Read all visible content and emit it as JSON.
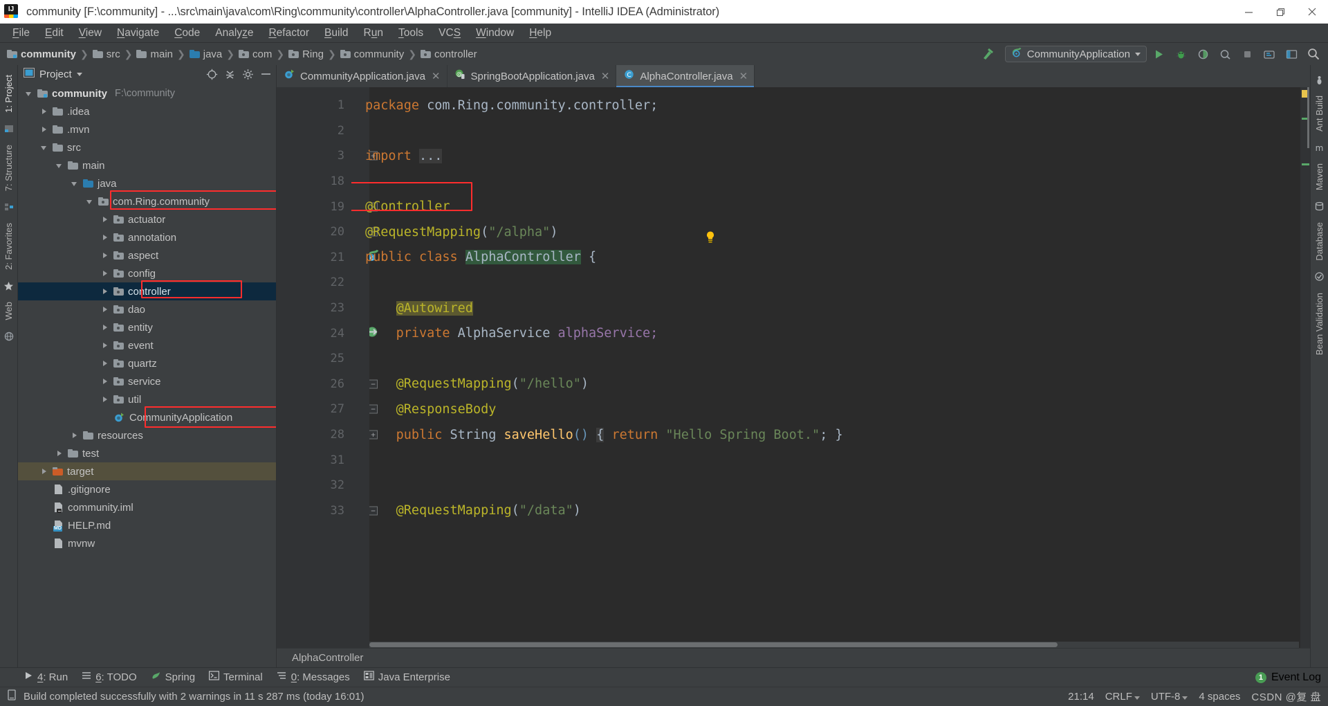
{
  "window": {
    "title": "community [F:\\community] - ...\\src\\main\\java\\com\\Ring\\community\\controller\\AlphaController.java [community] - IntelliJ IDEA (Administrator)",
    "app_icon": "intellij-idea-icon",
    "minimize": "minimize-icon",
    "restore": "restore-icon",
    "close": "close-icon"
  },
  "menubar": {
    "items": [
      {
        "label": "File",
        "mnemonic": "F"
      },
      {
        "label": "Edit",
        "mnemonic": "E"
      },
      {
        "label": "View",
        "mnemonic": "V"
      },
      {
        "label": "Navigate",
        "mnemonic": "N"
      },
      {
        "label": "Code",
        "mnemonic": "C"
      },
      {
        "label": "Analyze",
        "mnemonic": "z"
      },
      {
        "label": "Refactor",
        "mnemonic": "R"
      },
      {
        "label": "Build",
        "mnemonic": "B"
      },
      {
        "label": "Run",
        "mnemonic": "u"
      },
      {
        "label": "Tools",
        "mnemonic": "T"
      },
      {
        "label": "VCS",
        "mnemonic": "S"
      },
      {
        "label": "Window",
        "mnemonic": "W"
      },
      {
        "label": "Help",
        "mnemonic": "H"
      }
    ]
  },
  "navbar": {
    "breadcrumbs": [
      {
        "label": "community",
        "icon": "module-folder-icon"
      },
      {
        "label": "src",
        "icon": "folder-icon"
      },
      {
        "label": "main",
        "icon": "folder-icon"
      },
      {
        "label": "java",
        "icon": "source-root-folder-icon"
      },
      {
        "label": "com",
        "icon": "package-icon"
      },
      {
        "label": "Ring",
        "icon": "package-icon"
      },
      {
        "label": "community",
        "icon": "package-icon"
      },
      {
        "label": "controller",
        "icon": "package-icon"
      }
    ],
    "separator": "›",
    "run_config": {
      "label": "CommunityApplication",
      "icon": "spring-boot-run-icon",
      "dropdown": "chevron-down-icon"
    },
    "build_icon": "build-hammer-icon",
    "actions": [
      {
        "icon": "run-icon"
      },
      {
        "icon": "debug-icon"
      },
      {
        "icon": "run-coverage-icon"
      },
      {
        "icon": "profiler-icon"
      },
      {
        "icon": "stop-icon"
      },
      {
        "icon": "update-project-icon"
      },
      {
        "icon": "layout-icon"
      },
      {
        "icon": "search-everywhere-icon"
      }
    ]
  },
  "left_strip": {
    "tabs": [
      {
        "label": "1: Project",
        "selected": true
      },
      {
        "label": "7: Structure",
        "selected": false
      },
      {
        "label": "2: Favorites",
        "selected": false
      },
      {
        "label": "Web",
        "selected": false
      }
    ]
  },
  "right_strip": {
    "tabs": [
      {
        "label": "Ant Build"
      },
      {
        "label": "Maven"
      },
      {
        "label": "Database"
      },
      {
        "label": "Bean Validation"
      }
    ]
  },
  "project_panel": {
    "title": "Project",
    "title_caret": "chevron-down-icon",
    "buttons": [
      {
        "icon": "locate-target-icon"
      },
      {
        "icon": "collapse-all-icon"
      },
      {
        "icon": "gear-icon"
      },
      {
        "icon": "hide-panel-icon"
      }
    ],
    "tree": [
      {
        "label": "community",
        "sub": "F:\\community",
        "indent": 0,
        "arrow": "down",
        "icon": "module-folder-icon",
        "bold": true
      },
      {
        "label": ".idea",
        "indent": 1,
        "arrow": "right",
        "icon": "folder-icon"
      },
      {
        "label": ".mvn",
        "indent": 1,
        "arrow": "right",
        "icon": "folder-icon"
      },
      {
        "label": "src",
        "indent": 1,
        "arrow": "down",
        "icon": "folder-icon"
      },
      {
        "label": "main",
        "indent": 2,
        "arrow": "down",
        "icon": "folder-icon"
      },
      {
        "label": "java",
        "indent": 3,
        "arrow": "down",
        "icon": "source-root-folder-icon"
      },
      {
        "label": "com.Ring.community",
        "indent": 4,
        "arrow": "down",
        "icon": "package-icon",
        "highlight": true
      },
      {
        "label": "actuator",
        "indent": 5,
        "arrow": "right",
        "icon": "package-icon"
      },
      {
        "label": "annotation",
        "indent": 5,
        "arrow": "right",
        "icon": "package-icon"
      },
      {
        "label": "aspect",
        "indent": 5,
        "arrow": "right",
        "icon": "package-icon"
      },
      {
        "label": "config",
        "indent": 5,
        "arrow": "right",
        "icon": "package-icon"
      },
      {
        "label": "controller",
        "indent": 5,
        "arrow": "right",
        "icon": "package-icon",
        "selected": true,
        "highlight": true
      },
      {
        "label": "dao",
        "indent": 5,
        "arrow": "right",
        "icon": "package-icon"
      },
      {
        "label": "entity",
        "indent": 5,
        "arrow": "right",
        "icon": "package-icon"
      },
      {
        "label": "event",
        "indent": 5,
        "arrow": "right",
        "icon": "package-icon"
      },
      {
        "label": "quartz",
        "indent": 5,
        "arrow": "right",
        "icon": "package-icon"
      },
      {
        "label": "service",
        "indent": 5,
        "arrow": "right",
        "icon": "package-icon"
      },
      {
        "label": "util",
        "indent": 5,
        "arrow": "right",
        "icon": "package-icon"
      },
      {
        "label": "CommunityApplication",
        "indent": 5,
        "arrow": "none",
        "icon": "spring-boot-class-icon",
        "highlight": true
      },
      {
        "label": "resources",
        "indent": 3,
        "arrow": "right",
        "icon": "resources-folder-icon"
      },
      {
        "label": "test",
        "indent": 2,
        "arrow": "right",
        "icon": "folder-icon"
      },
      {
        "label": "target",
        "indent": 1,
        "arrow": "right",
        "icon": "excluded-folder-icon",
        "inactive_selected": true
      },
      {
        "label": ".gitignore",
        "indent": 1,
        "arrow": "none",
        "icon": "file-icon"
      },
      {
        "label": "community.iml",
        "indent": 1,
        "arrow": "none",
        "icon": "iml-file-icon"
      },
      {
        "label": "HELP.md",
        "indent": 1,
        "arrow": "none",
        "icon": "markdown-file-icon"
      },
      {
        "label": "mvnw",
        "indent": 1,
        "arrow": "none",
        "icon": "file-icon"
      }
    ]
  },
  "editor": {
    "tabs": [
      {
        "label": "CommunityApplication.java",
        "icon": "spring-boot-class-icon",
        "active": false,
        "close": "close-icon"
      },
      {
        "label": "SpringBootApplication.java",
        "icon": "annotation-class-icon",
        "active": false,
        "close": "close-icon"
      },
      {
        "label": "AlphaController.java",
        "icon": "java-class-icon",
        "active": true,
        "close": "close-icon"
      }
    ],
    "lines": [
      {
        "num": "1",
        "fold": "",
        "marker": ""
      },
      {
        "num": "2",
        "fold": "",
        "marker": ""
      },
      {
        "num": "3",
        "fold": "plus",
        "marker": ""
      },
      {
        "num": "18",
        "fold": "",
        "marker": ""
      },
      {
        "num": "19",
        "fold": "top",
        "marker": "",
        "highlight": true
      },
      {
        "num": "20",
        "fold": "minus",
        "marker": ""
      },
      {
        "num": "21",
        "fold": "",
        "marker": "spring-bean-icon"
      },
      {
        "num": "22",
        "fold": "",
        "marker": ""
      },
      {
        "num": "23",
        "fold": "",
        "marker": ""
      },
      {
        "num": "24",
        "fold": "",
        "marker": "autowired-icon"
      },
      {
        "num": "25",
        "fold": "",
        "marker": ""
      },
      {
        "num": "26",
        "fold": "minus",
        "marker": ""
      },
      {
        "num": "27",
        "fold": "minus",
        "marker": ""
      },
      {
        "num": "28",
        "fold": "plus",
        "marker": ""
      },
      {
        "num": "31",
        "fold": "",
        "marker": ""
      },
      {
        "num": "32",
        "fold": "",
        "marker": ""
      },
      {
        "num": "33",
        "fold": "minus",
        "marker": ""
      }
    ],
    "code": {
      "l1_kw": "package",
      "l1_rest": " com.Ring.community.controller;",
      "l3_kw": "import",
      "l3_dots": "...",
      "l19_annotation": "@Controller",
      "l20_annotation": "@RequestMapping",
      "l20_paren_open": "(",
      "l20_string": "\"/alpha\"",
      "l20_paren_close": ")",
      "l21_public": "public",
      "l21_class": "class",
      "l21_name": "AlphaController",
      "l21_brace": " {",
      "l23_annotation": "@Autowired",
      "l24_private": "private",
      "l24_type": "AlphaService",
      "l24_field": "alphaService",
      "l24_semi": ";",
      "l26_annotation": "@RequestMapping",
      "l26_string": "\"/hello\"",
      "l27_annotation": "@ResponseBody",
      "l28_public": "public",
      "l28_type": "String",
      "l28_method": "saveHello",
      "l28_parens": "()",
      "l28_brace_open": "{",
      "l28_return": "return",
      "l28_string": "\"Hello Spring Boot.\"",
      "l28_semi": ";",
      "l28_brace_close": "}",
      "l33_annotation": "@RequestMapping",
      "l33_string": "\"/data\""
    },
    "bulb_icon": "intention-bulb-icon",
    "status_breadcrumb": "AlphaController"
  },
  "tool_windows": {
    "items": [
      {
        "label": "4: Run",
        "mnemonic": "4",
        "icon": "run-icon"
      },
      {
        "label": "6: TODO",
        "mnemonic": "6",
        "icon": "todo-icon"
      },
      {
        "label": "Spring",
        "mnemonic": "",
        "icon": "spring-leaf-icon"
      },
      {
        "label": "Terminal",
        "mnemonic": "",
        "icon": "terminal-icon"
      },
      {
        "label": "0: Messages",
        "mnemonic": "0",
        "icon": "messages-icon"
      },
      {
        "label": "Java Enterprise",
        "mnemonic": "",
        "icon": "java-enterprise-icon"
      }
    ],
    "event_log": {
      "label": "Event Log",
      "count": "1"
    }
  },
  "statusbar": {
    "icon": "build-status-icon",
    "message": "Build completed successfully with 2 warnings in 11 s 287 ms (today 16:01)",
    "caret_position": "21:14",
    "line_separator": "CRLF",
    "encoding": "UTF-8",
    "indent": "4 spaces",
    "watermark": "CSDN @复 盘"
  },
  "colors": {
    "accent_blue": "#4a88c7",
    "selection_blue": "#0d293e",
    "highlight_red": "#ff2d2d",
    "panel_bg": "#3c3f41",
    "editor_bg": "#2b2b2b",
    "gutter_bg": "#313335"
  }
}
